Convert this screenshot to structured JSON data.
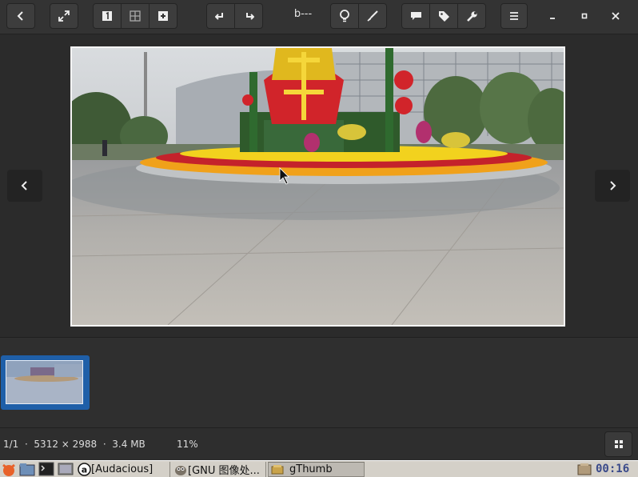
{
  "toolbar": {
    "title": "b---",
    "buttons": [
      "back-icon",
      "fullscreen-icon",
      "single-view-icon",
      "grid-view-icon",
      "add-icon",
      "rotate-left-icon",
      "rotate-right-icon",
      "lightbulb-icon",
      "brush-icon",
      "comment-icon",
      "tag-icon",
      "wrench-icon",
      "menu-icon",
      "minimize-icon",
      "maximize-icon",
      "close-icon"
    ]
  },
  "viewer": {
    "prev": "chevron-left-icon",
    "next": "chevron-right-icon"
  },
  "status": {
    "position": "1/1",
    "dimensions": "5312 × 2988",
    "size": "3.4 MB",
    "separator": "·",
    "zoom": "11%"
  },
  "taskbar": {
    "tasks": [
      "[Audacious]",
      "[GNU 图像处...",
      "gThumb"
    ],
    "clock": "00:16"
  },
  "colors": {
    "accent": "#1f5fa8",
    "toolbar": "#333333",
    "background": "#2b2b2b"
  }
}
